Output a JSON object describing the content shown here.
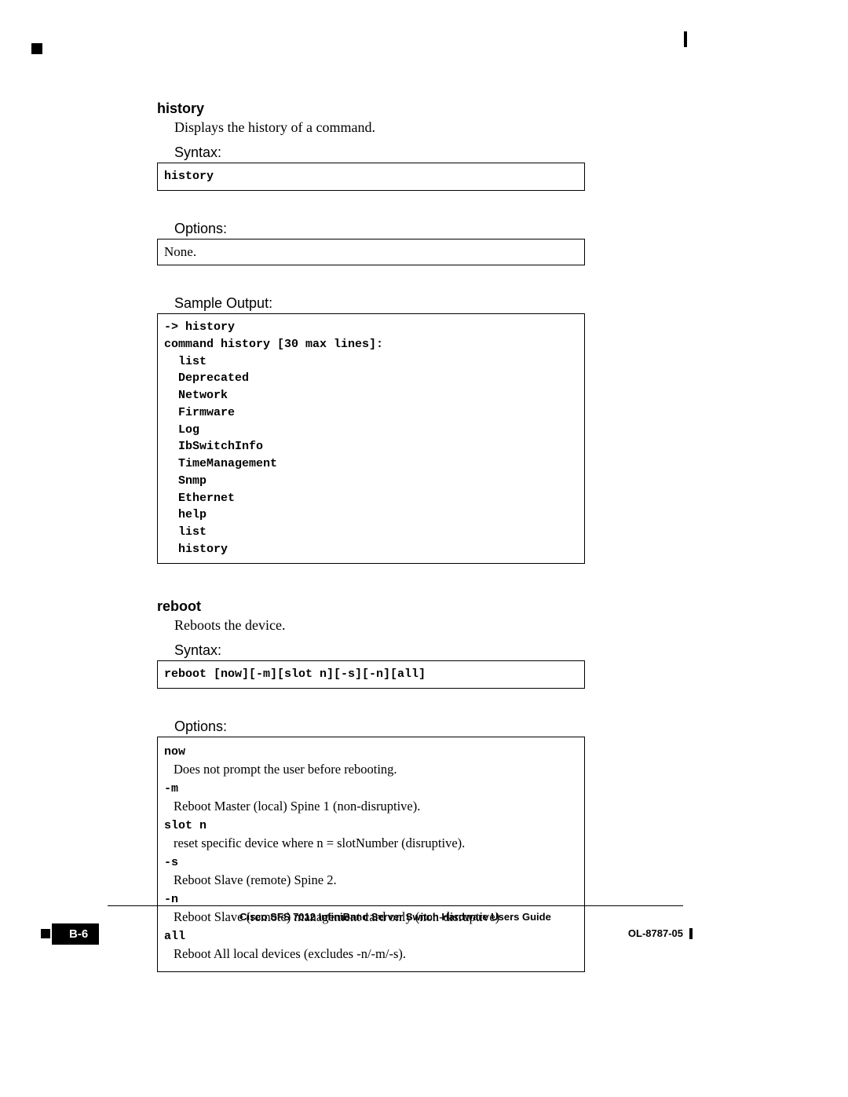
{
  "page": {
    "number": "B-6",
    "footer_title": "Cisco SFS 7012 InfiniBand Server Switch Hardware Users Guide",
    "doc_id": "OL-8787-05"
  },
  "labels": {
    "syntax": "Syntax:",
    "options": "Options:",
    "sample_output": "Sample Output:"
  },
  "history": {
    "heading": "history",
    "description": "Displays the history of a command.",
    "syntax": "history",
    "options": "None.",
    "sample_output": "-> history\ncommand history [30 max lines]:\n  list\n  Deprecated\n  Network\n  Firmware\n  Log\n  IbSwitchInfo\n  TimeManagement\n  Snmp\n  Ethernet\n  help\n  list\n  history"
  },
  "reboot": {
    "heading": "reboot",
    "description": "Reboots the device.",
    "syntax": "reboot [now][-m][slot n][-s][-n][all]",
    "options": [
      {
        "name": "now",
        "desc": "Does not prompt the user before rebooting."
      },
      {
        "name": "-m",
        "desc": "Reboot Master (local) Spine 1 (non-disruptive)."
      },
      {
        "name": "slot n",
        "desc": "reset specific device where n = slotNumber (disruptive)."
      },
      {
        "name": "-s",
        "desc": "Reboot Slave (remote) Spine 2."
      },
      {
        "name": "-n",
        "desc": "Reboot Slave (remote)  management card only (non-disruptive)"
      },
      {
        "name": "all",
        "desc": "Reboot All local devices (excludes -n/-m/-s)."
      }
    ]
  }
}
